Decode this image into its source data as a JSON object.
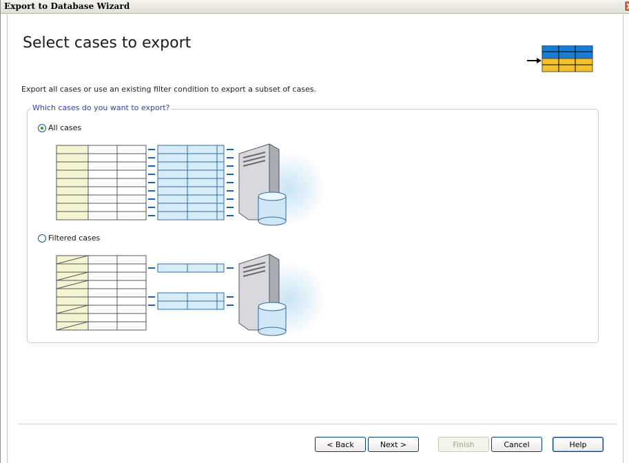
{
  "window": {
    "title": "Export to Database Wizard"
  },
  "page": {
    "heading": "Select cases to export",
    "description": "Export all cases or use an existing filter condition to export a subset of cases."
  },
  "group": {
    "legend": "Which cases do you want to export?",
    "options": [
      {
        "label": "All cases",
        "selected": true
      },
      {
        "label": "Filtered cases",
        "selected": false
      }
    ]
  },
  "buttons": {
    "back": "< Back",
    "next": "Next >",
    "finish": "Finish",
    "cancel": "Cancel",
    "help": "Help"
  },
  "colors": {
    "accent_blue": "#1a7bd3",
    "accent_yellow": "#f2c12e",
    "legend_text": "#2946a8",
    "table_yellow": "#f4f3d2",
    "table_blue": "#d6ecf8"
  }
}
